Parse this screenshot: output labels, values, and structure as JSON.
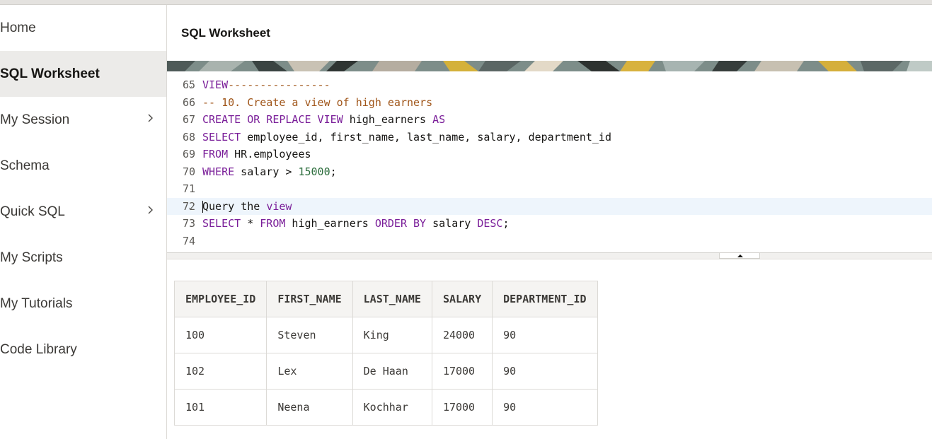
{
  "sidebar": {
    "items": [
      {
        "label": "Home",
        "active": false,
        "has_submenu": false
      },
      {
        "label": "SQL Worksheet",
        "active": true,
        "has_submenu": false
      },
      {
        "label": "My Session",
        "active": false,
        "has_submenu": true
      },
      {
        "label": "Schema",
        "active": false,
        "has_submenu": false
      },
      {
        "label": "Quick SQL",
        "active": false,
        "has_submenu": true
      },
      {
        "label": "My Scripts",
        "active": false,
        "has_submenu": false
      },
      {
        "label": "My Tutorials",
        "active": false,
        "has_submenu": false
      },
      {
        "label": "Code Library",
        "active": false,
        "has_submenu": false
      }
    ],
    "chevron_icon": "chevron-right-icon"
  },
  "header": {
    "title": "SQL Worksheet"
  },
  "editor": {
    "lines": [
      {
        "num": "65",
        "fold": true
      },
      {
        "num": "66",
        "fold": false
      },
      {
        "num": "67",
        "fold": false
      },
      {
        "num": "68",
        "fold": false
      },
      {
        "num": "69",
        "fold": false
      },
      {
        "num": "70",
        "fold": false
      },
      {
        "num": "71",
        "fold": false
      },
      {
        "num": "72",
        "fold": true
      },
      {
        "num": "73",
        "fold": false
      },
      {
        "num": "74",
        "fold": false
      }
    ],
    "tokens": {
      "l65_kw": "VIEW",
      "l65_cm": "----------------",
      "l66_cm": "-- 10. Create a view of high earners",
      "l67_kw1": "CREATE OR REPLACE VIEW",
      "l67_t1": " high_earners ",
      "l67_kw2": "AS",
      "l68_kw": "SELECT",
      "l68_t": " employee_id, first_name, last_name, salary, department_id",
      "l69_kw": "FROM",
      "l69_t": " HR.employees",
      "l70_kw": "WHERE",
      "l70_t": " salary > ",
      "l70_num": "15000",
      "l70_end": ";",
      "l72_t": "Query the ",
      "l72_kw": "view",
      "l73_kw1": "SELECT",
      "l73_t1": " * ",
      "l73_kw2": "FROM",
      "l73_t2": " high_earners ",
      "l73_kw3": "ORDER BY",
      "l73_t3": " salary ",
      "l73_kw4": "DESC",
      "l73_end": ";"
    },
    "current_line": "72",
    "fold_icon": "fold-chevron-icon"
  },
  "splitter": {
    "icon": "caret-up-icon"
  },
  "results": {
    "columns": [
      "EMPLOYEE_ID",
      "FIRST_NAME",
      "LAST_NAME",
      "SALARY",
      "DEPARTMENT_ID"
    ],
    "rows": [
      [
        "100",
        "Steven",
        "King",
        "24000",
        "90"
      ],
      [
        "102",
        "Lex",
        "De Haan",
        "17000",
        "90"
      ],
      [
        "101",
        "Neena",
        "Kochhar",
        "17000",
        "90"
      ]
    ]
  },
  "colors": {
    "keyword": "#7a1e99",
    "comment": "#a0561a",
    "number": "#2d6e3e",
    "active_nav_bg": "#ecebe9",
    "current_line_bg": "#eef5fc"
  }
}
